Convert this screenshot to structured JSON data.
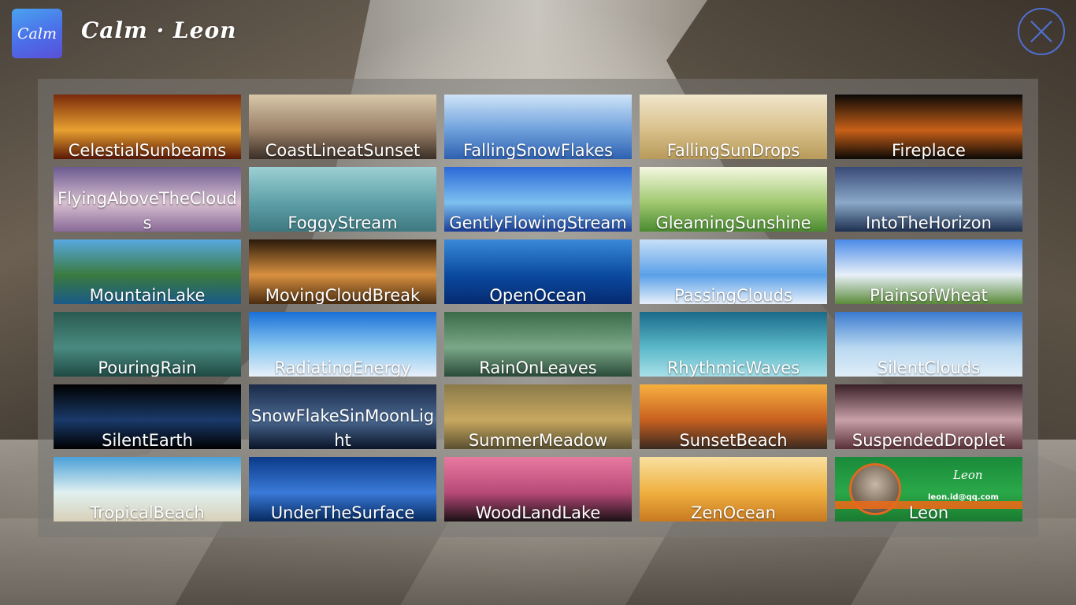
{
  "app": {
    "logo_text": "Calm",
    "title": "Calm · Leon"
  },
  "icons": {
    "close": "close-icon"
  },
  "tiles": [
    {
      "label": "CelestialSunbeams",
      "colors": [
        "#7a2a0a",
        "#e8a030",
        "#5a1806"
      ]
    },
    {
      "label": "CoastLineatSunset",
      "colors": [
        "#d8c8a8",
        "#9a8068",
        "#3a2e26"
      ]
    },
    {
      "label": "FallingSnowFlakes",
      "colors": [
        "#cfe4f8",
        "#6ea0dc",
        "#2e60b0"
      ]
    },
    {
      "label": "FallingSunDrops",
      "colors": [
        "#f0e6cc",
        "#d8c08a",
        "#b89a5a"
      ]
    },
    {
      "label": "Fireplace",
      "colors": [
        "#0a0806",
        "#c86018",
        "#0a0806"
      ]
    },
    {
      "label": "FlyingAboveTheClouds",
      "colors": [
        "#6c5a90",
        "#d8c0d0",
        "#8a6a98"
      ]
    },
    {
      "label": "FoggyStream",
      "colors": [
        "#9ccfd4",
        "#5ea0a8",
        "#3e7880"
      ]
    },
    {
      "label": "GentlyFlowingStream",
      "colors": [
        "#2c6ad8",
        "#7cc0f0",
        "#1a3e98"
      ]
    },
    {
      "label": "GleamingSunshine",
      "colors": [
        "#f4f8e0",
        "#a0c870",
        "#4a8a30"
      ]
    },
    {
      "label": "IntoTheHorizon",
      "colors": [
        "#3a4a78",
        "#8aa8c8",
        "#1e3050"
      ]
    },
    {
      "label": "MountainLake",
      "colors": [
        "#58a8e0",
        "#3a7a40",
        "#1a5a88"
      ]
    },
    {
      "label": "MovingCloudBreak",
      "colors": [
        "#2a1a0a",
        "#d89040",
        "#4a2c10"
      ]
    },
    {
      "label": "OpenOcean",
      "colors": [
        "#3a8ad8",
        "#0a4aa0",
        "#062a70"
      ]
    },
    {
      "label": "PassingClouds",
      "colors": [
        "#c8e0f8",
        "#5aa0e8",
        "#e8f0fa"
      ]
    },
    {
      "label": "PlainsofWheat",
      "colors": [
        "#4a8ae8",
        "#e8f0f8",
        "#5a8a3a"
      ]
    },
    {
      "label": "PouringRain",
      "colors": [
        "#2a5a50",
        "#4a8a80",
        "#1e4a44"
      ]
    },
    {
      "label": "RadiatingEnergy",
      "colors": [
        "#1a70d8",
        "#8ac8f0",
        "#e8f0fa"
      ]
    },
    {
      "label": "RainOnLeaves",
      "colors": [
        "#3a6a48",
        "#7aa888",
        "#2a4a38"
      ]
    },
    {
      "label": "RhythmicWaves",
      "colors": [
        "#1a6a8a",
        "#5ab8c8",
        "#a8e0e8"
      ]
    },
    {
      "label": "SilentClouds",
      "colors": [
        "#3a7ad0",
        "#b8d8f0",
        "#e0eef8"
      ]
    },
    {
      "label": "SilentEarth",
      "colors": [
        "#000000",
        "#1a3a6a",
        "#000000"
      ]
    },
    {
      "label": "SnowFlakeSinMoonLight",
      "colors": [
        "#1a2a48",
        "#4a6890",
        "#0a1428"
      ]
    },
    {
      "label": "SummerMeadow",
      "colors": [
        "#8a7a4a",
        "#c8a860",
        "#5a5030"
      ]
    },
    {
      "label": "SunsetBeach",
      "colors": [
        "#f8b040",
        "#c86020",
        "#3a2a20"
      ]
    },
    {
      "label": "SuspendedDroplet",
      "colors": [
        "#3a2028",
        "#c8a0a8",
        "#5a3038"
      ]
    },
    {
      "label": "TropicalBeach",
      "colors": [
        "#4aa0d8",
        "#e0f0f0",
        "#d8d0b8"
      ]
    },
    {
      "label": "UnderTheSurface",
      "colors": [
        "#0a3a88",
        "#3a7ad8",
        "#062a60"
      ]
    },
    {
      "label": "WoodLandLake",
      "colors": [
        "#e87aa0",
        "#b84a78",
        "#1a1014"
      ]
    },
    {
      "label": "ZenOcean",
      "colors": [
        "#f8e0a0",
        "#f0b040",
        "#c87a20"
      ]
    },
    {
      "label": "Leon",
      "colors": [
        "#1a8a3a",
        "#2aa848",
        "#1a7a30"
      ],
      "extra": {
        "script_name": "Leon",
        "email": "leon.id@qq.com"
      }
    }
  ]
}
